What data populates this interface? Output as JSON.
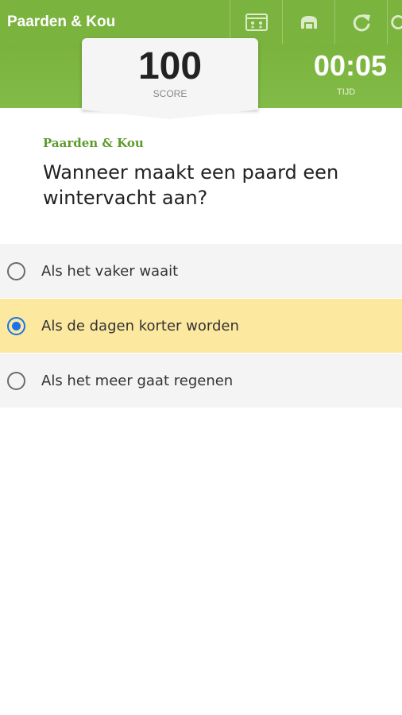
{
  "header": {
    "title": "Paarden & Kou",
    "buttons": [
      {
        "icon": "quiz-card-icon"
      },
      {
        "icon": "leaderboard-icon"
      },
      {
        "icon": "restart-icon"
      },
      {
        "icon": "more-icon"
      }
    ]
  },
  "score": {
    "value": "100",
    "label": "SCORE"
  },
  "timer": {
    "value": "00:05",
    "label": "TIJD"
  },
  "question": {
    "category": "Paarden & Kou",
    "text": "Wanneer maakt een paard een wintervacht aan?"
  },
  "answers": [
    {
      "label": "Als het vaker waait",
      "selected": false
    },
    {
      "label": "Als de dagen korter worden",
      "selected": true
    },
    {
      "label": "Als het meer gaat regenen",
      "selected": false
    }
  ],
  "colors": {
    "brand_green": "#7bb33f",
    "selected_answer": "#fde8a0",
    "radio_selected": "#1a73e8",
    "category_text": "#5d9a2b"
  }
}
